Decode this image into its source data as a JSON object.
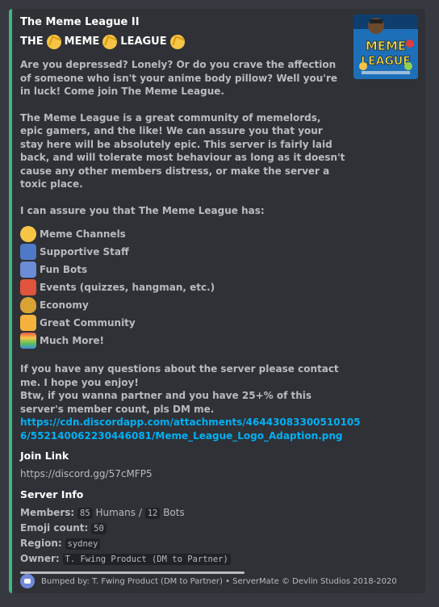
{
  "embed": {
    "author": "The Meme League II",
    "title_words": [
      "THE",
      "MEME",
      "LEAGUE"
    ],
    "description": [
      "Are you depressed? Lonely? Or do you crave the affection of someone who isn't your anime body pillow? Well you're in luck! Come join The Meme League.",
      "The Meme League is a great community of memelords, epic gamers, and the like! We can assure you that your stay here will be absolutely epic. This server is fairly laid back, and will tolerate most behaviour as long as it doesn't cause any other members distress, or make the server a toxic place.",
      "I can assure you that The Meme League has:"
    ],
    "features": [
      {
        "icon": "laughing-emoji",
        "label": "Meme Channels",
        "color": "#f6c545"
      },
      {
        "icon": "police-officer-emoji",
        "label": "Supportive Staff",
        "color": "#4f78c6"
      },
      {
        "icon": "robot-emoji",
        "label": "Fun Bots",
        "color": "#6c8cd5"
      },
      {
        "icon": "party-popper-emoji",
        "label": "Events (quizzes, hangman, etc.)",
        "color": "#e0533c"
      },
      {
        "icon": "money-bag-emoji",
        "label": "Economy",
        "color": "#d8a235"
      },
      {
        "icon": "family-emoji",
        "label": "Great Community",
        "color": "#f4b23c"
      },
      {
        "icon": "rainbow-emoji",
        "label": "Much More!",
        "color": "#e95c4a"
      }
    ],
    "contact_text": "If you have any questions about the server please contact me. I hope you enjoy!",
    "partner_text": "Btw, if you wanna partner and you have 25+% of this server's member count, pls DM me.",
    "image_link": "https://cdn.discordapp.com/attachments/46443083300510105 6/552140062230446081/Meme_League_Logo_Adaption.png",
    "join_label": "Join Link",
    "join_url": "https://discord.gg/57cMFP5",
    "server_info_label": "Server Info",
    "members_label": "Members:",
    "humans": "85",
    "humans_suffix": "Humans /",
    "bots": "12",
    "bots_suffix": "Bots",
    "emoji_label": "Emoji count:",
    "emoji_count": "50",
    "region_label": "Region:",
    "region": "sydney",
    "owner_label": "Owner:",
    "owner": "T. Fwing Product (DM to Partner)",
    "footer": "Bumped by: T. Fwing Product (DM to Partner) • ServerMate © Devlin Studios 2018-2020",
    "thumbnail_text": "MEME LEAGUE",
    "accent": "#43b581",
    "link_color": "#00b0f4"
  }
}
